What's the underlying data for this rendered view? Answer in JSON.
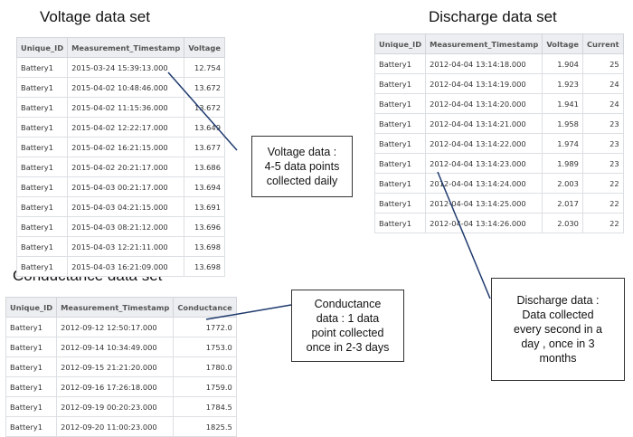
{
  "voltage": {
    "title": "Voltage data set",
    "columns": [
      "Unique_ID",
      "Measurement_Timestamp",
      "Voltage"
    ],
    "rows": [
      [
        "Battery1",
        "2015-03-24 15:39:13.000",
        "12.754"
      ],
      [
        "Battery1",
        "2015-04-02 10:48:46.000",
        "13.672"
      ],
      [
        "Battery1",
        "2015-04-02 11:15:36.000",
        "13.672"
      ],
      [
        "Battery1",
        "2015-04-02 12:22:17.000",
        "13.649"
      ],
      [
        "Battery1",
        "2015-04-02 16:21:15.000",
        "13.677"
      ],
      [
        "Battery1",
        "2015-04-02 20:21:17.000",
        "13.686"
      ],
      [
        "Battery1",
        "2015-04-03 00:21:17.000",
        "13.694"
      ],
      [
        "Battery1",
        "2015-04-03 04:21:15.000",
        "13.691"
      ],
      [
        "Battery1",
        "2015-04-03 08:21:12.000",
        "13.696"
      ],
      [
        "Battery1",
        "2015-04-03 12:21:11.000",
        "13.698"
      ],
      [
        "Battery1",
        "2015-04-03 16:21:09.000",
        "13.698"
      ]
    ],
    "note": [
      "Voltage data :",
      "4-5 data points",
      "collected daily"
    ]
  },
  "discharge": {
    "title": "Discharge data set",
    "columns": [
      "Unique_ID",
      "Measurement_Timestamp",
      "Voltage",
      "Current"
    ],
    "rows": [
      [
        "Battery1",
        "2012-04-04 13:14:18.000",
        "1.904",
        "25"
      ],
      [
        "Battery1",
        "2012-04-04 13:14:19.000",
        "1.923",
        "24"
      ],
      [
        "Battery1",
        "2012-04-04 13:14:20.000",
        "1.941",
        "24"
      ],
      [
        "Battery1",
        "2012-04-04 13:14:21.000",
        "1.958",
        "23"
      ],
      [
        "Battery1",
        "2012-04-04 13:14:22.000",
        "1.974",
        "23"
      ],
      [
        "Battery1",
        "2012-04-04 13:14:23.000",
        "1.989",
        "23"
      ],
      [
        "Battery1",
        "2012-04-04 13:14:24.000",
        "2.003",
        "22"
      ],
      [
        "Battery1",
        "2012-04-04 13:14:25.000",
        "2.017",
        "22"
      ],
      [
        "Battery1",
        "2012-04-04 13:14:26.000",
        "2.030",
        "22"
      ]
    ],
    "note": [
      "Discharge data :",
      "Data collected",
      "every second in a",
      "day , once in 3",
      "months"
    ]
  },
  "conductance": {
    "title": "Conductance data set",
    "columns": [
      "Unique_ID",
      "Measurement_Timestamp",
      "Conductance"
    ],
    "rows": [
      [
        "Battery1",
        "2012-09-12 12:50:17.000",
        "1772.0"
      ],
      [
        "Battery1",
        "2012-09-14 10:34:49.000",
        "1753.0"
      ],
      [
        "Battery1",
        "2012-09-15 21:21:20.000",
        "1780.0"
      ],
      [
        "Battery1",
        "2012-09-16 17:26:18.000",
        "1759.0"
      ],
      [
        "Battery1",
        "2012-09-19 00:20:23.000",
        "1784.5"
      ],
      [
        "Battery1",
        "2012-09-20 11:00:23.000",
        "1825.5"
      ]
    ],
    "note": [
      "Conductance",
      "data : 1 data",
      "point collected",
      "once in 2-3 days"
    ]
  }
}
